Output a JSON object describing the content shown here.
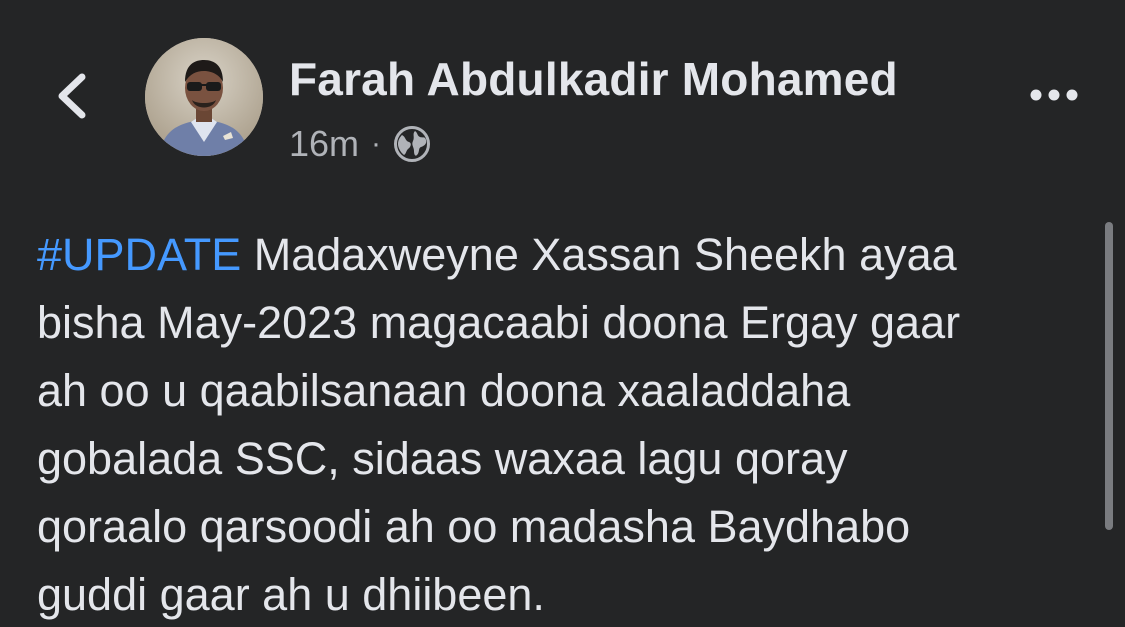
{
  "header": {
    "author_name": "Farah Abdulkadir Mohamed",
    "timestamp": "16m",
    "separator": "·",
    "audience_icon": "globe-icon",
    "back_icon": "chevron-left-icon",
    "more_icon": "more-options-icon"
  },
  "post": {
    "hashtag": "#UPDATE",
    "lines": [
      " Madaxweyne Xassan Sheekh ayaa",
      "bisha May-2023 magacaabi doona Ergay gaar",
      "ah oo u qaabilsanaan doona xaaladdaha",
      "gobalada SSC, sidaas waxaa lagu qoray",
      "qoraalo qarsoodi ah oo madasha Baydhabo",
      "guddi gaar ah u dhiibeen."
    ]
  },
  "colors": {
    "background": "#242526",
    "text_primary": "#e4e6eb",
    "text_secondary": "#b0b3b8",
    "hashtag": "#4599ff"
  }
}
